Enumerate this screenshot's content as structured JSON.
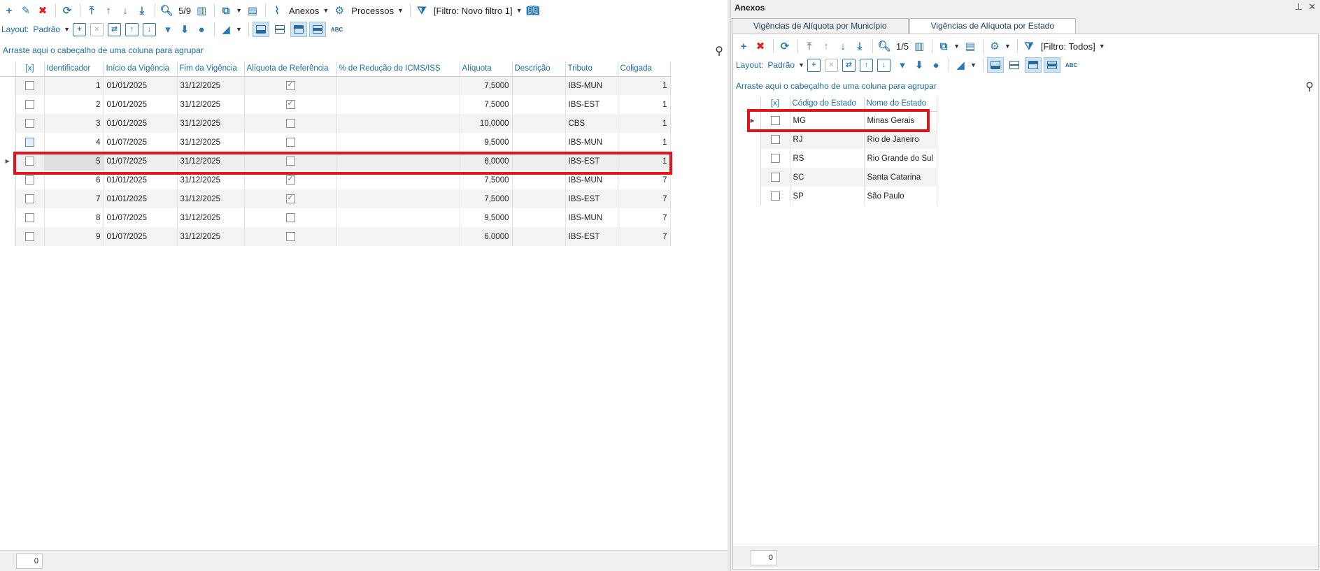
{
  "main": {
    "toolbar": {
      "record_counter": "5/9",
      "anexos_label": "Anexos",
      "processos_label": "Processos",
      "filter_label": "[Filtro: Novo filtro 1]"
    },
    "layout_bar": {
      "label": "Layout:",
      "preset": "Padrão",
      "abc": "ABC"
    },
    "group_hint": "Arraste aqui o cabeçalho de uma coluna para agrupar",
    "columns": [
      "[x]",
      "Identificador",
      "Início da Vigência",
      "Fim da Vigência",
      "Alíquota de Referência",
      "% de Redução do ICMS/ISS",
      "Alíquota",
      "Descrição",
      "Tributo",
      "Coligada"
    ],
    "rows": [
      {
        "id": "1",
        "inicio": "01/01/2025",
        "fim": "31/12/2025",
        "ref": true,
        "red": "",
        "aliquota": "7,5000",
        "desc": "",
        "tributo": "IBS-MUN",
        "coligada": "1"
      },
      {
        "id": "2",
        "inicio": "01/01/2025",
        "fim": "31/12/2025",
        "ref": true,
        "red": "",
        "aliquota": "7,5000",
        "desc": "",
        "tributo": "IBS-EST",
        "coligada": "1"
      },
      {
        "id": "3",
        "inicio": "01/01/2025",
        "fim": "31/12/2025",
        "ref": false,
        "red": "",
        "aliquota": "10,0000",
        "desc": "",
        "tributo": "CBS",
        "coligada": "1"
      },
      {
        "id": "4",
        "inicio": "01/07/2025",
        "fim": "31/12/2025",
        "ref": false,
        "red": "",
        "aliquota": "9,5000",
        "desc": "",
        "tributo": "IBS-MUN",
        "coligada": "1"
      },
      {
        "id": "5",
        "inicio": "01/07/2025",
        "fim": "31/12/2025",
        "ref": false,
        "red": "",
        "aliquota": "6,0000",
        "desc": "",
        "tributo": "IBS-EST",
        "coligada": "1"
      },
      {
        "id": "6",
        "inicio": "01/01/2025",
        "fim": "31/12/2025",
        "ref": true,
        "red": "",
        "aliquota": "7,5000",
        "desc": "",
        "tributo": "IBS-MUN",
        "coligada": "7"
      },
      {
        "id": "7",
        "inicio": "01/01/2025",
        "fim": "31/12/2025",
        "ref": true,
        "red": "",
        "aliquota": "7,5000",
        "desc": "",
        "tributo": "IBS-EST",
        "coligada": "7"
      },
      {
        "id": "8",
        "inicio": "01/07/2025",
        "fim": "31/12/2025",
        "ref": false,
        "red": "",
        "aliquota": "9,5000",
        "desc": "",
        "tributo": "IBS-MUN",
        "coligada": "7"
      },
      {
        "id": "9",
        "inicio": "01/07/2025",
        "fim": "31/12/2025",
        "ref": false,
        "red": "",
        "aliquota": "6,0000",
        "desc": "",
        "tributo": "IBS-EST",
        "coligada": "7"
      }
    ],
    "selected_row_id": "5",
    "footer_count": "0"
  },
  "panel": {
    "title": "Anexos",
    "tabs": [
      "Vigências de Alíquota por Município",
      "Vigências de Alíquota por Estado"
    ],
    "active_tab": 1,
    "toolbar": {
      "record_counter": "1/5",
      "filter_label": "[Filtro: Todos]"
    },
    "layout_bar": {
      "label": "Layout:",
      "preset": "Padrão",
      "abc": "ABC"
    },
    "group_hint": "Arraste aqui o cabeçalho de uma coluna para agrupar",
    "columns": [
      "[x]",
      "Código do Estado",
      "Nome do Estado"
    ],
    "rows": [
      {
        "codigo": "MG",
        "nome": "Minas Gerais"
      },
      {
        "codigo": "RJ",
        "nome": "Rio de Janeiro"
      },
      {
        "codigo": "RS",
        "nome": "Rio Grande do Sul"
      },
      {
        "codigo": "SC",
        "nome": "Santa Catarina"
      },
      {
        "codigo": "SP",
        "nome": "São Paulo"
      }
    ],
    "footer_count": "0"
  }
}
